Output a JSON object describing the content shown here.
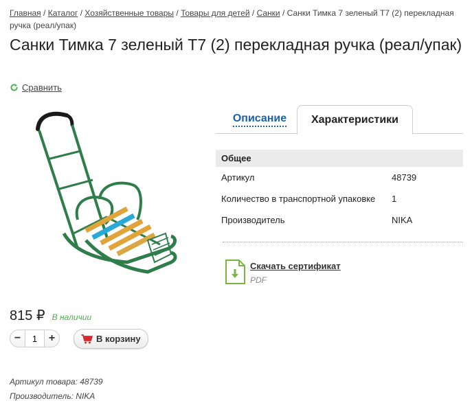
{
  "breadcrumb": {
    "items": [
      "Главная",
      "Каталог",
      "Хозяйственные товары",
      "Товары для детей",
      "Санки"
    ],
    "current": "Санки Тимка 7 зеленый Т7 (2) перекладная ручка (реал/упак)",
    "separator": "/"
  },
  "product": {
    "title": "Санки Тимка 7 зеленый Т7 (2) перекладная ручка (реал/упак)",
    "compare_label": "Сравнить",
    "image_icon": "green-sled-with-push-handle"
  },
  "tabs": [
    {
      "label": "Описание",
      "active": false
    },
    {
      "label": "Характеристики",
      "active": true
    }
  ],
  "specs": {
    "group_title": "Общее",
    "rows": [
      {
        "key": "Артикул",
        "value": "48739"
      },
      {
        "key": "Количество в транспортной упаковке",
        "value": "1"
      },
      {
        "key": "Производитель",
        "value": "NIKA"
      }
    ]
  },
  "certificate": {
    "link": "Скачать сертификат",
    "format": "PDF",
    "icon": "document-download-icon"
  },
  "purchase": {
    "price": "815 ₽",
    "stock": "В наличии",
    "quantity": "1",
    "minus": "−",
    "plus": "+",
    "cart_label": "В корзину"
  },
  "meta": {
    "article": "Артикул товара: 48739",
    "manufacturer": "Производитель: NIKA"
  },
  "colors": {
    "link_blue": "#1b5fa8",
    "stock_green": "#4caf50",
    "cart_red": "#d9272e",
    "sled_green": "#2e7d4a",
    "cert_green": "#7cb342"
  }
}
